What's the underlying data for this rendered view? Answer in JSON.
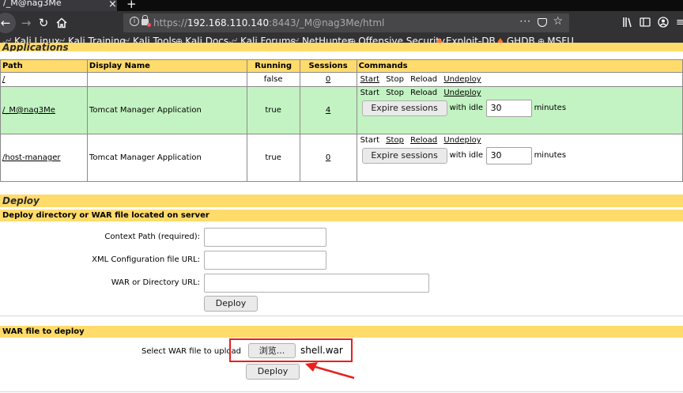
{
  "browser": {
    "tab_title": "/_M@nag3Me",
    "new_tab": "+",
    "url": {
      "scheme": "https://",
      "host": "192.168.110.140",
      "port": ":8443",
      "path": "/_M@nag3Me/html"
    },
    "url_menu": "···",
    "bookmarks": [
      {
        "label": "Kali Linux",
        "icon": "kali-dragon-icon"
      },
      {
        "label": "Kali Training",
        "icon": "kali-dragon-icon"
      },
      {
        "label": "Kali Tools",
        "icon": "kali-dragon-icon"
      },
      {
        "label": "Kali Docs",
        "icon": "globe-icon"
      },
      {
        "label": "Kali Forums",
        "icon": "kali-dragon-icon"
      },
      {
        "label": "NetHunter",
        "icon": "kali-dragon-icon"
      },
      {
        "label": "Offensive Security",
        "icon": "globe-icon"
      },
      {
        "label": "Exploit-DB",
        "icon": "flame-icon"
      },
      {
        "label": "GHDB",
        "icon": "flame-icon"
      },
      {
        "label": "MSFU",
        "icon": "globe-icon"
      }
    ]
  },
  "applications": {
    "title": "Applications",
    "columns": [
      "Path",
      "Display Name",
      "Running",
      "Sessions",
      "Commands"
    ],
    "rows": [
      {
        "path": "/",
        "display_name": "",
        "running": "false",
        "sessions": "0",
        "commands": [
          "Start",
          "Stop",
          "Reload",
          "Undeploy"
        ]
      },
      {
        "path": "/_M@nag3Me",
        "display_name": "Tomcat Manager Application",
        "running": "true",
        "sessions": "4",
        "commands": [
          "Start",
          "Stop",
          "Reload",
          "Undeploy"
        ]
      },
      {
        "path": "/host-manager",
        "display_name": "Tomcat Manager Application",
        "running": "true",
        "sessions": "0",
        "commands": [
          "Start",
          "Stop",
          "Reload",
          "Undeploy"
        ]
      }
    ],
    "expire_button": "Expire sessions",
    "idle_label": "with idle ≥",
    "idle_value": "30",
    "idle_unit": "minutes"
  },
  "deploy": {
    "title": "Deploy",
    "server_section": "Deploy directory or WAR file located on server",
    "context_path_label": "Context Path (required):",
    "xml_config_label": "XML Configuration file URL:",
    "war_dir_label": "WAR or Directory URL:",
    "deploy_button": "Deploy",
    "war_section": "WAR file to deploy",
    "select_war_label": "Select WAR file to upload",
    "browse_button": "浏览...",
    "selected_file": "shell.war",
    "war_deploy_button": "Deploy"
  },
  "colors": {
    "section_header": "#ffdb6b",
    "row_highlight": "#c3f3c3",
    "annotation": "#e8201d"
  }
}
